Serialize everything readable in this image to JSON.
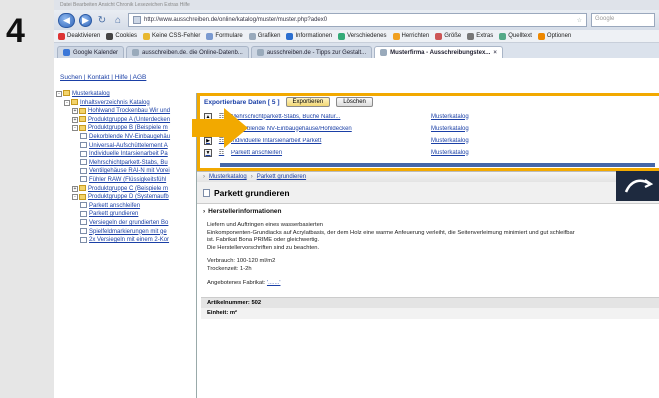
{
  "step_number": "4",
  "system_bar": "Datei Bearbeiten Ansicht Chronik Lesezeichen Extras Hilfe",
  "browser": {
    "url": "http://www.ausschreiben.de/online/katalog/muster/muster.php?adex0",
    "search_placeholder": "Google",
    "bookmarks": [
      "Deaktivieren",
      "Cookies",
      "Keine CSS-Fehler",
      "Formulare",
      "Grafiken",
      "Informationen",
      "Verschiedenes",
      "Herrichten",
      "Größe",
      "Extras",
      "Quelltext",
      "Optionen"
    ],
    "tabs": [
      "Google Kalender",
      "ausschreiben.de. die Online-Datenb...",
      "ausschreiben.de - Tipps zur Gestalt...",
      "Musterfirma - Ausschreibungstex..."
    ]
  },
  "toplinks": "Suchen | Kontakt | Hilfe | AGB",
  "tree": [
    {
      "label": "Musterkatalog",
      "type": "folder",
      "level": 0,
      "exp": "-"
    },
    {
      "label": "Inhaltsverzeichnis Katalog",
      "type": "folder",
      "level": 1,
      "exp": "-"
    },
    {
      "label": "Hohlwand Trockenbau Wir und",
      "type": "folder",
      "level": 2,
      "exp": "+"
    },
    {
      "label": "Produktgruppe A (Unterdecken",
      "type": "folder",
      "level": 2,
      "exp": "+"
    },
    {
      "label": "Produktgruppe B (Beispiele m",
      "type": "folder",
      "level": 2,
      "exp": "-"
    },
    {
      "label": "Dekorblende NV-Einbaugehäu",
      "type": "doc",
      "level": 3
    },
    {
      "label": "Universal-Aufschüttelement A",
      "type": "doc",
      "level": 3
    },
    {
      "label": "Individuelle Intarsienarbeit Pa",
      "type": "doc",
      "level": 3
    },
    {
      "label": "Mehrschichtparkett-Stabs, Bu",
      "type": "doc",
      "level": 3
    },
    {
      "label": "Ventilgehäuse RAI-N mit Vorei",
      "type": "doc",
      "level": 3
    },
    {
      "label": "Fühler RAW (Flüssigkeitsfühl",
      "type": "doc",
      "level": 3
    },
    {
      "label": "Produktgruppe C (Beispiele m",
      "type": "folder",
      "level": 2,
      "exp": "+"
    },
    {
      "label": "Produktgruppe D (Systemaufb",
      "type": "folder",
      "level": 2,
      "exp": "-"
    },
    {
      "label": "Parkett anschleifen",
      "type": "doc",
      "level": 3
    },
    {
      "label": "Parkett grundieren",
      "type": "doc",
      "level": 3
    },
    {
      "label": "Versiegeln der grundierten Bo",
      "type": "doc",
      "level": 3
    },
    {
      "label": "Spielfeldmarkierungen mit ge",
      "type": "doc",
      "level": 3
    },
    {
      "label": "2x Versiegeln mit einem 2-Kor",
      "type": "doc",
      "level": 3
    }
  ],
  "export": {
    "title": "Exportierbare Daten [ 5 ]",
    "export_button": "Exportieren",
    "delete_button": "Löschen",
    "rows": [
      {
        "ctrl": "▲",
        "name": "Mehrschichtparkett-Stabs, Buche Natur...",
        "catalog": "Musterkatalog"
      },
      {
        "ctrl": "▶",
        "name": "Dekorblende NV-Einbaugehäuse/Hohldecken",
        "catalog": "Musterkatalog"
      },
      {
        "ctrl": "▶",
        "name": "Individuelle Intarsienarbeit Parkett",
        "catalog": "Musterkatalog"
      },
      {
        "ctrl": "▼",
        "name": "Parkett anschleifen",
        "catalog": "Musterkatalog"
      }
    ]
  },
  "breadcrumb": [
    "Musterkatalog",
    "Parkett grundieren"
  ],
  "detail": {
    "title": "Parkett grundieren",
    "section": "Herstellerinformationen",
    "desc_lines": [
      "Liefern und Auftringen eines wasserbasierten",
      "Einkomponenten-Grundiacks auf Acrylatbasis, der dem Holz eine warme Anfeuerung verleiht, die Seitenverleimung minimiert und gut schleifbar",
      "ist. Fabrikat Bona PRIME oder gleichwertig.",
      "Die Herstellervorschriften sind zu beachten."
    ],
    "consumption": "Verbrauch: 100-120 ml/m2",
    "drying": "Trockenzeit: 1-2h",
    "offered_label": "Angebotenes Fabrikat:",
    "offered_value": "'.......'",
    "article_label": "Artikelnummer: 502",
    "unit_label": "Einheit: m²"
  }
}
